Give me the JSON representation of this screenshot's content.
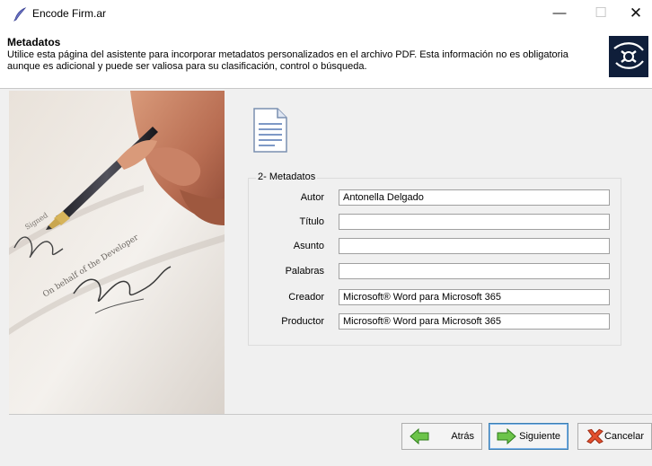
{
  "window": {
    "title": "Encode Firm.ar",
    "minimize_glyph": "—",
    "maximize_glyph": "☐",
    "close_glyph": "✕"
  },
  "header": {
    "title": "Metadatos",
    "description": "Utilice esta página del asistente para incorporar metadatos personalizados en el archivo PDF. Esta información no es obligatoria aunque es adicional y puede ser valiosa para su clasificación, control o búsqueda.",
    "logo_icon": "certificate-seal-icon"
  },
  "side_image": {
    "icon": "pen-signing-document-photo"
  },
  "group": {
    "legend": "2- Metadatos",
    "fields": [
      {
        "label": "Autor",
        "value": "Antonella Delgado"
      },
      {
        "label": "Título",
        "value": ""
      },
      {
        "label": "Asunto",
        "value": ""
      },
      {
        "label": "Palabras",
        "value": ""
      },
      {
        "label": "Creador",
        "value": "Microsoft® Word para Microsoft 365"
      },
      {
        "label": "Productor",
        "value": "Microsoft® Word para Microsoft 365"
      }
    ]
  },
  "buttons": {
    "back": "Atrás",
    "next": "Siguiente",
    "cancel": "Cancelar"
  },
  "colors": {
    "window_bg": "#f0f0f0",
    "accent_green": "#4cb02a",
    "cancel_red": "#d93a1e",
    "focus_blue": "#3c7fb1"
  }
}
